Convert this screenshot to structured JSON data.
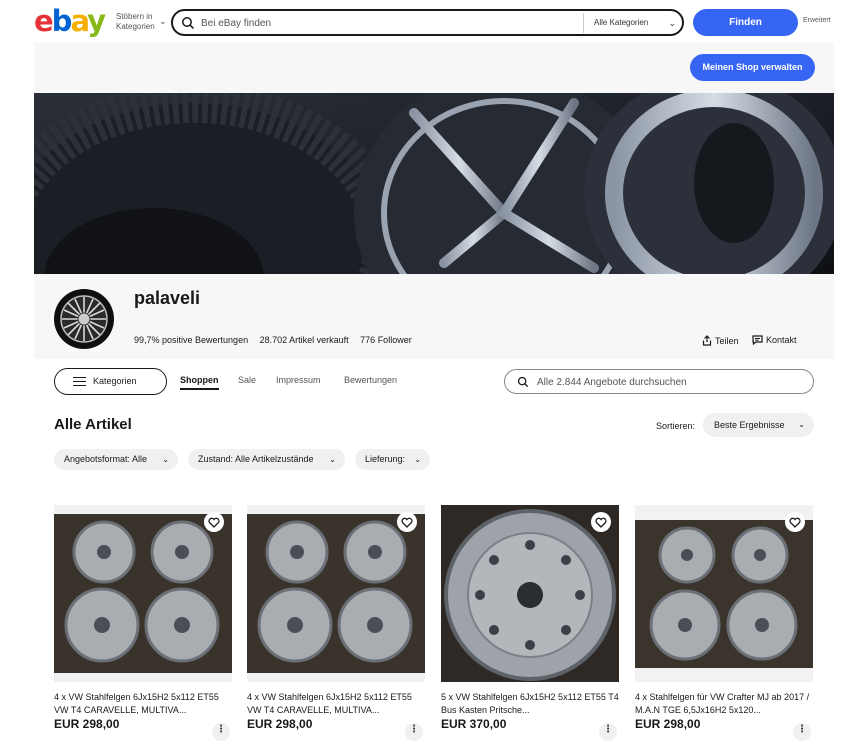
{
  "header": {
    "logo": {
      "e": "e",
      "b": "b",
      "a": "a",
      "y": "y"
    },
    "shop_by": "Stöbern in Kategorien",
    "search_placeholder": "Bei eBay finden",
    "category_select": "Alle Kategorien",
    "find_label": "Finden",
    "advanced_label": "Erweitert"
  },
  "store": {
    "manage_label": "Meinen Shop verwalten",
    "name": "palaveli",
    "positive": "99,7% positive Bewertungen",
    "sold": "28.702 Artikel verkauft",
    "followers": "776 Follower",
    "share_label": "Teilen",
    "contact_label": "Kontakt"
  },
  "nav": {
    "categories_label": "Kategorien",
    "tabs": [
      "Shoppen",
      "Sale",
      "Impressum",
      "Bewertungen"
    ],
    "search_placeholder": "Alle 2.844 Angebote durchsuchen"
  },
  "listing": {
    "title": "Alle Artikel",
    "sort_label": "Sortieren:",
    "sort_value": "Beste Ergebnisse",
    "filters": [
      "Angebotsformat: Alle",
      "Zustand: Alle Artikelzustände",
      "Lieferung:"
    ]
  },
  "products": [
    {
      "title": "4 x VW Stahlfelgen 6Jx15H2 5x112 ET55 VW T4 CARAVELLE, MULTIVA...",
      "price": "EUR 298,00"
    },
    {
      "title": "4 x VW Stahlfelgen 6Jx15H2 5x112 ET55 VW T4 CARAVELLE, MULTIVA...",
      "price": "EUR 298,00"
    },
    {
      "title": "5 x VW Stahlfelgen 6Jx15H2 5x112 ET55 T4 Bus Kasten Pritsche...",
      "price": "EUR 370,00"
    },
    {
      "title": "4 x Stahlfelgen für VW Crafter MJ ab 2017 / M.A.N TGE 6,5Jx16H2 5x120...",
      "price": "EUR 298,00"
    }
  ],
  "colors": {
    "accent": "#3665f3",
    "panel": "#f7f7f7",
    "text": "#191919"
  },
  "icons": [
    "search-icon",
    "chevron-down-icon",
    "share-icon",
    "chat-icon",
    "menu-icon",
    "heart-icon",
    "more-icon"
  ]
}
